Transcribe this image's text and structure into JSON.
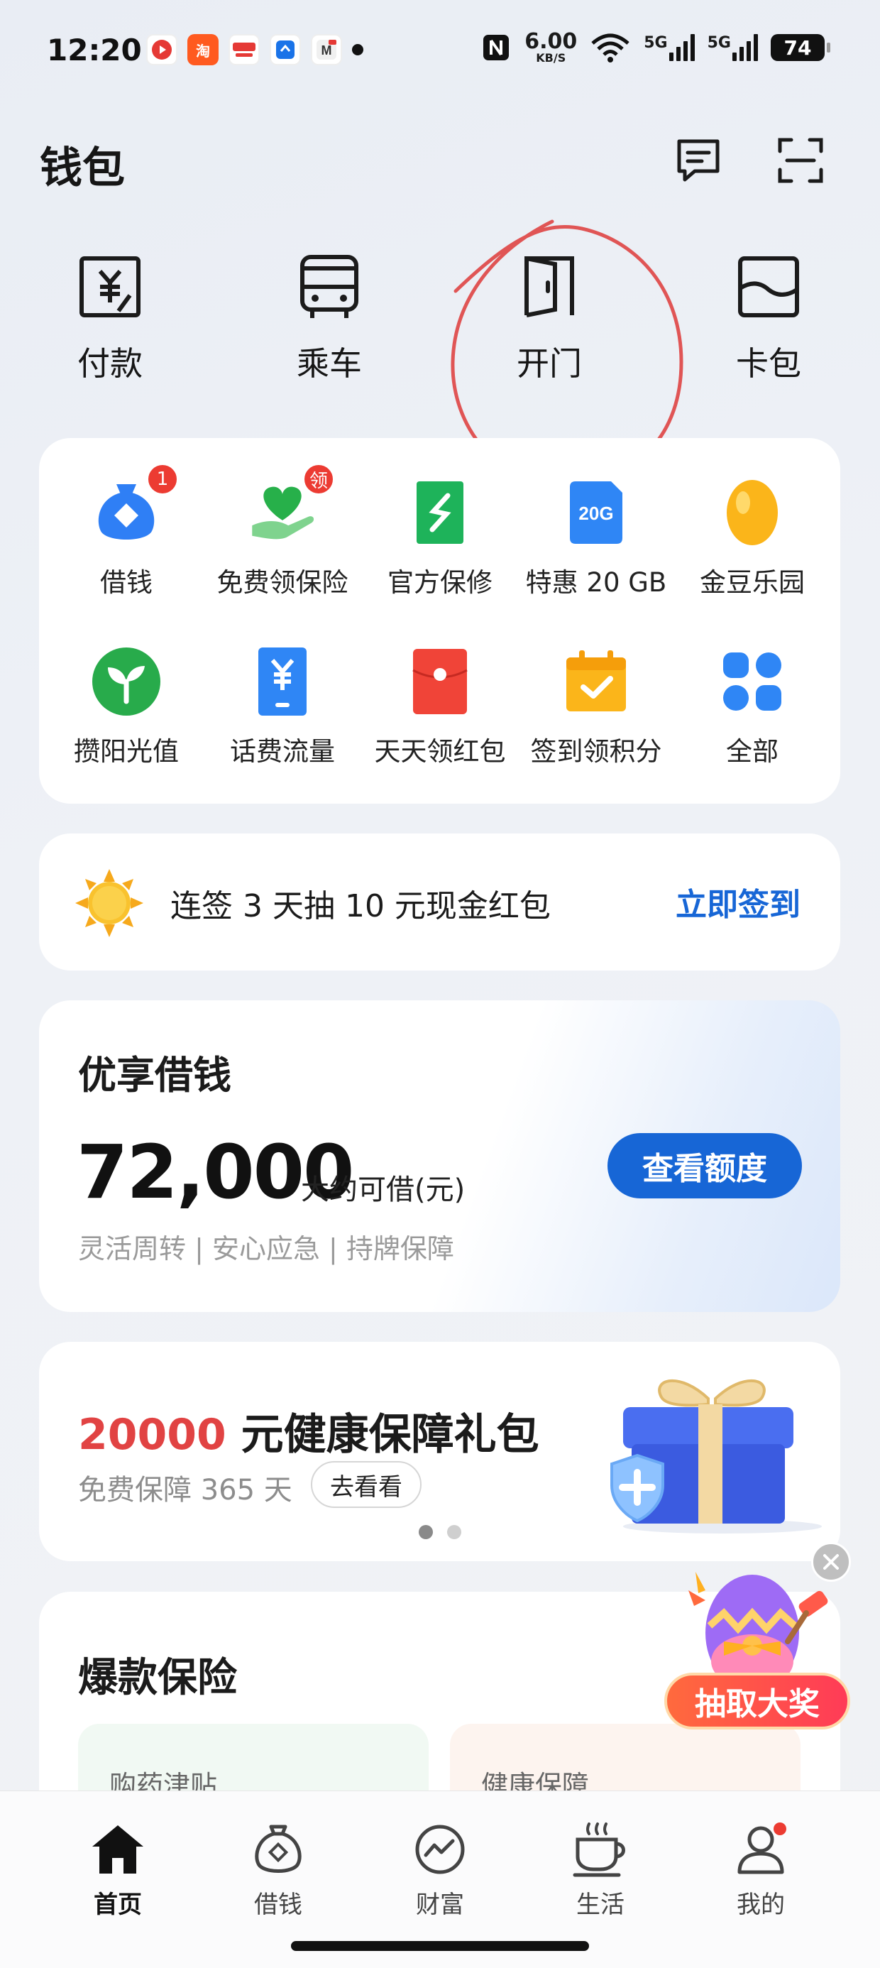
{
  "status_bar": {
    "time": "12:20",
    "net_speed_value": "6.00",
    "net_speed_unit": "KB/S",
    "signal1": "5G",
    "signal2": "5G",
    "battery": "74"
  },
  "header": {
    "title": "钱包",
    "message_icon": "message-icon",
    "scan_icon": "scan-icon"
  },
  "quick_actions": [
    {
      "label": "付款",
      "icon": "yuan-payment-icon"
    },
    {
      "label": "乘车",
      "icon": "bus-icon"
    },
    {
      "label": "开门",
      "icon": "door-icon"
    },
    {
      "label": "卡包",
      "icon": "card-wallet-icon"
    }
  ],
  "services": [
    {
      "label": "借钱",
      "badge": "1",
      "icon": "loan-bag-icon"
    },
    {
      "label": "免费领保险",
      "badge": "领",
      "icon": "insurance-hand-icon"
    },
    {
      "label": "官方保修",
      "badge": "",
      "icon": "repair-icon"
    },
    {
      "label": "特惠 20 GB",
      "badge": "",
      "icon": "data-20g-icon",
      "icon_text": "20G"
    },
    {
      "label": "金豆乐园",
      "badge": "",
      "icon": "golden-bean-icon"
    },
    {
      "label": "攒阳光值",
      "badge": "",
      "icon": "sprout-icon"
    },
    {
      "label": "话费流量",
      "badge": "",
      "icon": "phone-bill-icon"
    },
    {
      "label": "天天领红包",
      "badge": "",
      "icon": "red-envelope-icon"
    },
    {
      "label": "签到领积分",
      "badge": "",
      "icon": "calendar-check-icon"
    },
    {
      "label": "全部",
      "badge": "",
      "icon": "all-grid-icon"
    }
  ],
  "signin": {
    "text": "连签 3 天抽 10 元现金红包",
    "button": "立即签到"
  },
  "loan": {
    "title": "优享借钱",
    "amount": "72,000",
    "unit": "大约可借(元)",
    "subtitle": "灵活周转 | 安心应急 | 持牌保障",
    "button": "查看额度"
  },
  "insurance_banner": {
    "highlight": "20000",
    "title_rest": " 元健康保障礼包",
    "subtitle": "免费保障 365 天",
    "button": "去看看"
  },
  "hot_insurance": {
    "title": "爆款保险",
    "cards": [
      "购药津贴",
      "健康保障"
    ]
  },
  "floating": {
    "button": "抽取大奖"
  },
  "bottom_nav": [
    {
      "label": "首页",
      "icon": "home-icon",
      "active": true
    },
    {
      "label": "借钱",
      "icon": "money-bag-icon",
      "active": false
    },
    {
      "label": "财富",
      "icon": "wealth-chart-icon",
      "active": false
    },
    {
      "label": "生活",
      "icon": "coffee-cup-icon",
      "active": false
    },
    {
      "label": "我的",
      "icon": "user-icon",
      "active": false
    }
  ],
  "colors": {
    "accent_blue": "#1766d6",
    "badge_red": "#ec3b32",
    "highlight_red": "#e14343",
    "annotation_red": "#e05555"
  }
}
